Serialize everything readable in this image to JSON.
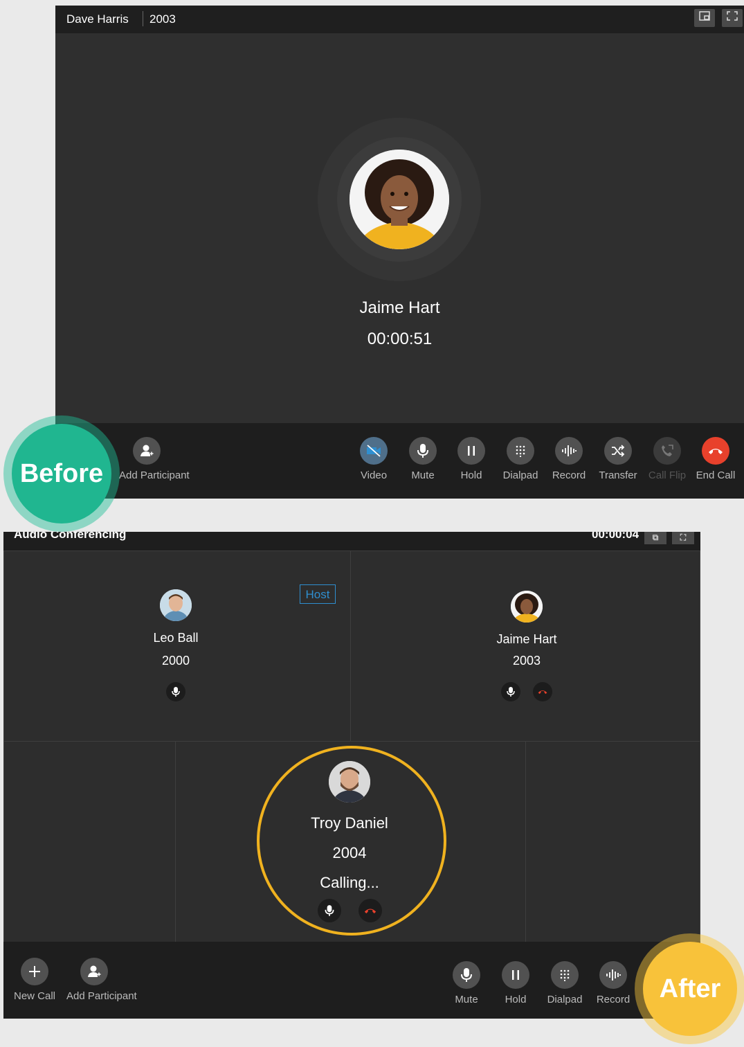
{
  "before_window": {
    "caller_name": "Dave Harris",
    "extension": "2003",
    "contact_name": "Jaime Hart",
    "timer": "00:00:51",
    "controls_left": [
      {
        "label": "Add Participant"
      }
    ],
    "controls": [
      {
        "label": "Video"
      },
      {
        "label": "Mute"
      },
      {
        "label": "Hold"
      },
      {
        "label": "Dialpad"
      },
      {
        "label": "Record"
      },
      {
        "label": "Transfer"
      },
      {
        "label": "Call Flip"
      },
      {
        "label": "End Call"
      }
    ]
  },
  "badges": {
    "before": "Before",
    "after": "After"
  },
  "after_window": {
    "title": "Audio Conferencing",
    "timer": "00:00:04",
    "host_label": "Host",
    "participants": [
      {
        "name": "Leo Ball",
        "ext": "2000"
      },
      {
        "name": "Jaime Hart",
        "ext": "2003"
      },
      {
        "name": "Troy Daniel",
        "ext": "2004",
        "status": "Calling..."
      }
    ],
    "controls_left": [
      {
        "label": "New Call"
      },
      {
        "label": "Add Participant"
      }
    ],
    "controls": [
      {
        "label": "Mute"
      },
      {
        "label": "Hold"
      },
      {
        "label": "Dialpad"
      },
      {
        "label": "Record"
      }
    ]
  },
  "colors": {
    "end_call": "#e8412c",
    "before_badge": "#20b690",
    "after_badge": "#f8c23a",
    "host": "#2f8fd0",
    "video_icon": "#2f8fd0"
  }
}
